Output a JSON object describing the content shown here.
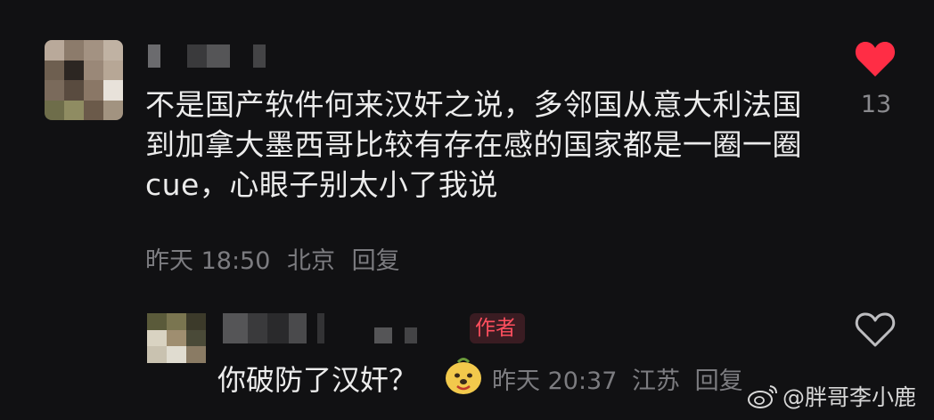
{
  "comment": {
    "text": "不是国产软件何来汉奸之说，多邻国从意大利法国到加拿大墨西哥比较有存在感的国家都是一圈一圈 cue，心眼子别太小了我说",
    "time": "昨天 18:50",
    "location": "北京",
    "reply_label": "回复",
    "like_count": "13",
    "liked": true,
    "avatar_colors": [
      "#b9a99a",
      "#8c7b6b",
      "#a39282",
      "#c0b2a3",
      "#6e5f50",
      "#2c2622",
      "#9a8878",
      "#b7a796",
      "#7a6a5b",
      "#594b3f",
      "#8a7766",
      "#e8e2da",
      "#6e6d4a",
      "#8f8c62",
      "#6b5a4a",
      "#a29380"
    ]
  },
  "reply": {
    "badge": "作者",
    "text": "你破防了汉奸？",
    "time": "昨天 20:37",
    "location": "江苏",
    "reply_label": "回复",
    "avatar_colors": [
      "#5a5a3a",
      "#7a7550",
      "#3c3a2a",
      "#d9d3c2",
      "#9f8e70",
      "#4a4a38",
      "#c9c2b0",
      "#e0dcd0",
      "#8a7b64"
    ]
  },
  "watermark": {
    "text": "@胖哥李小鹿"
  },
  "colors": {
    "background": "#111113",
    "heart": "#ff2d45",
    "meta": "#7c7c80"
  }
}
